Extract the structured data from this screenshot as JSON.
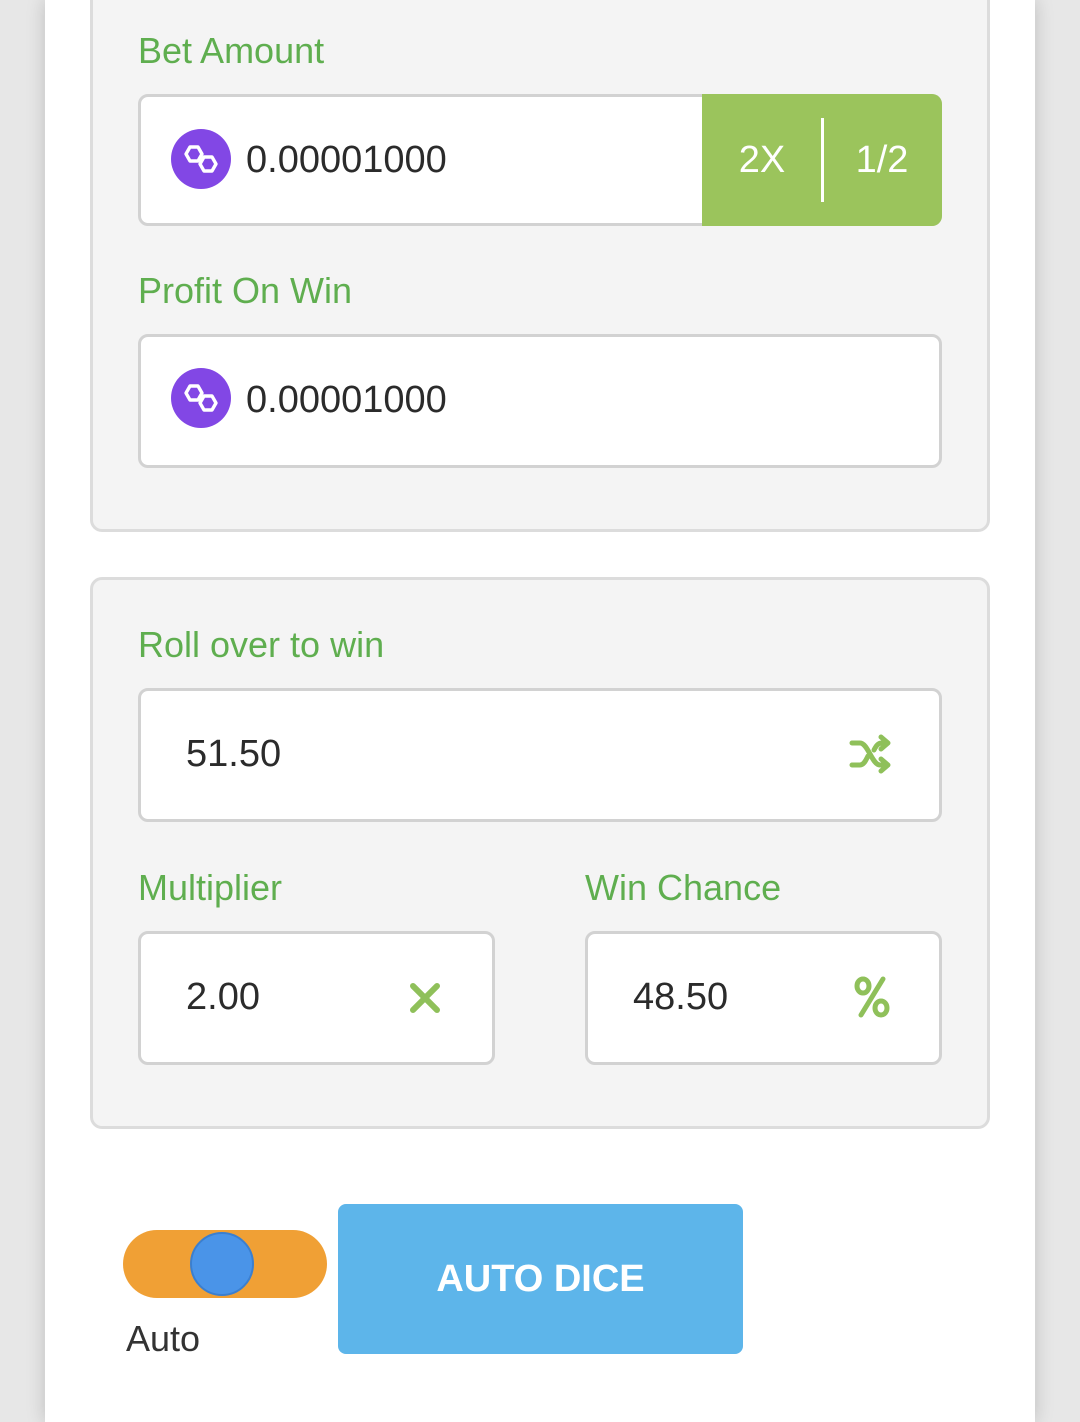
{
  "bet": {
    "label": "Bet Amount",
    "value": "0.00001000",
    "coin_icon": "polygon-matic-icon",
    "double_label": "2X",
    "half_label": "1/2"
  },
  "profit": {
    "label": "Profit On Win",
    "value": "0.00001000",
    "coin_icon": "polygon-matic-icon"
  },
  "roll": {
    "label": "Roll over to win",
    "value": "51.50",
    "icon": "shuffle-icon"
  },
  "multiplier": {
    "label": "Multiplier",
    "value": "2.00",
    "icon": "times-icon"
  },
  "win_chance": {
    "label": "Win Chance",
    "value": "48.50",
    "icon": "percent-icon"
  },
  "auto": {
    "toggle_label": "Auto",
    "button_label": "AUTO DICE"
  },
  "colors": {
    "label_green": "#5fae4f",
    "button_green": "#9bc45c",
    "coin_purple": "#8247e5",
    "toggle_orange": "#f0a035",
    "knob_blue": "#4a94e8",
    "main_button_blue": "#5db5ea"
  }
}
